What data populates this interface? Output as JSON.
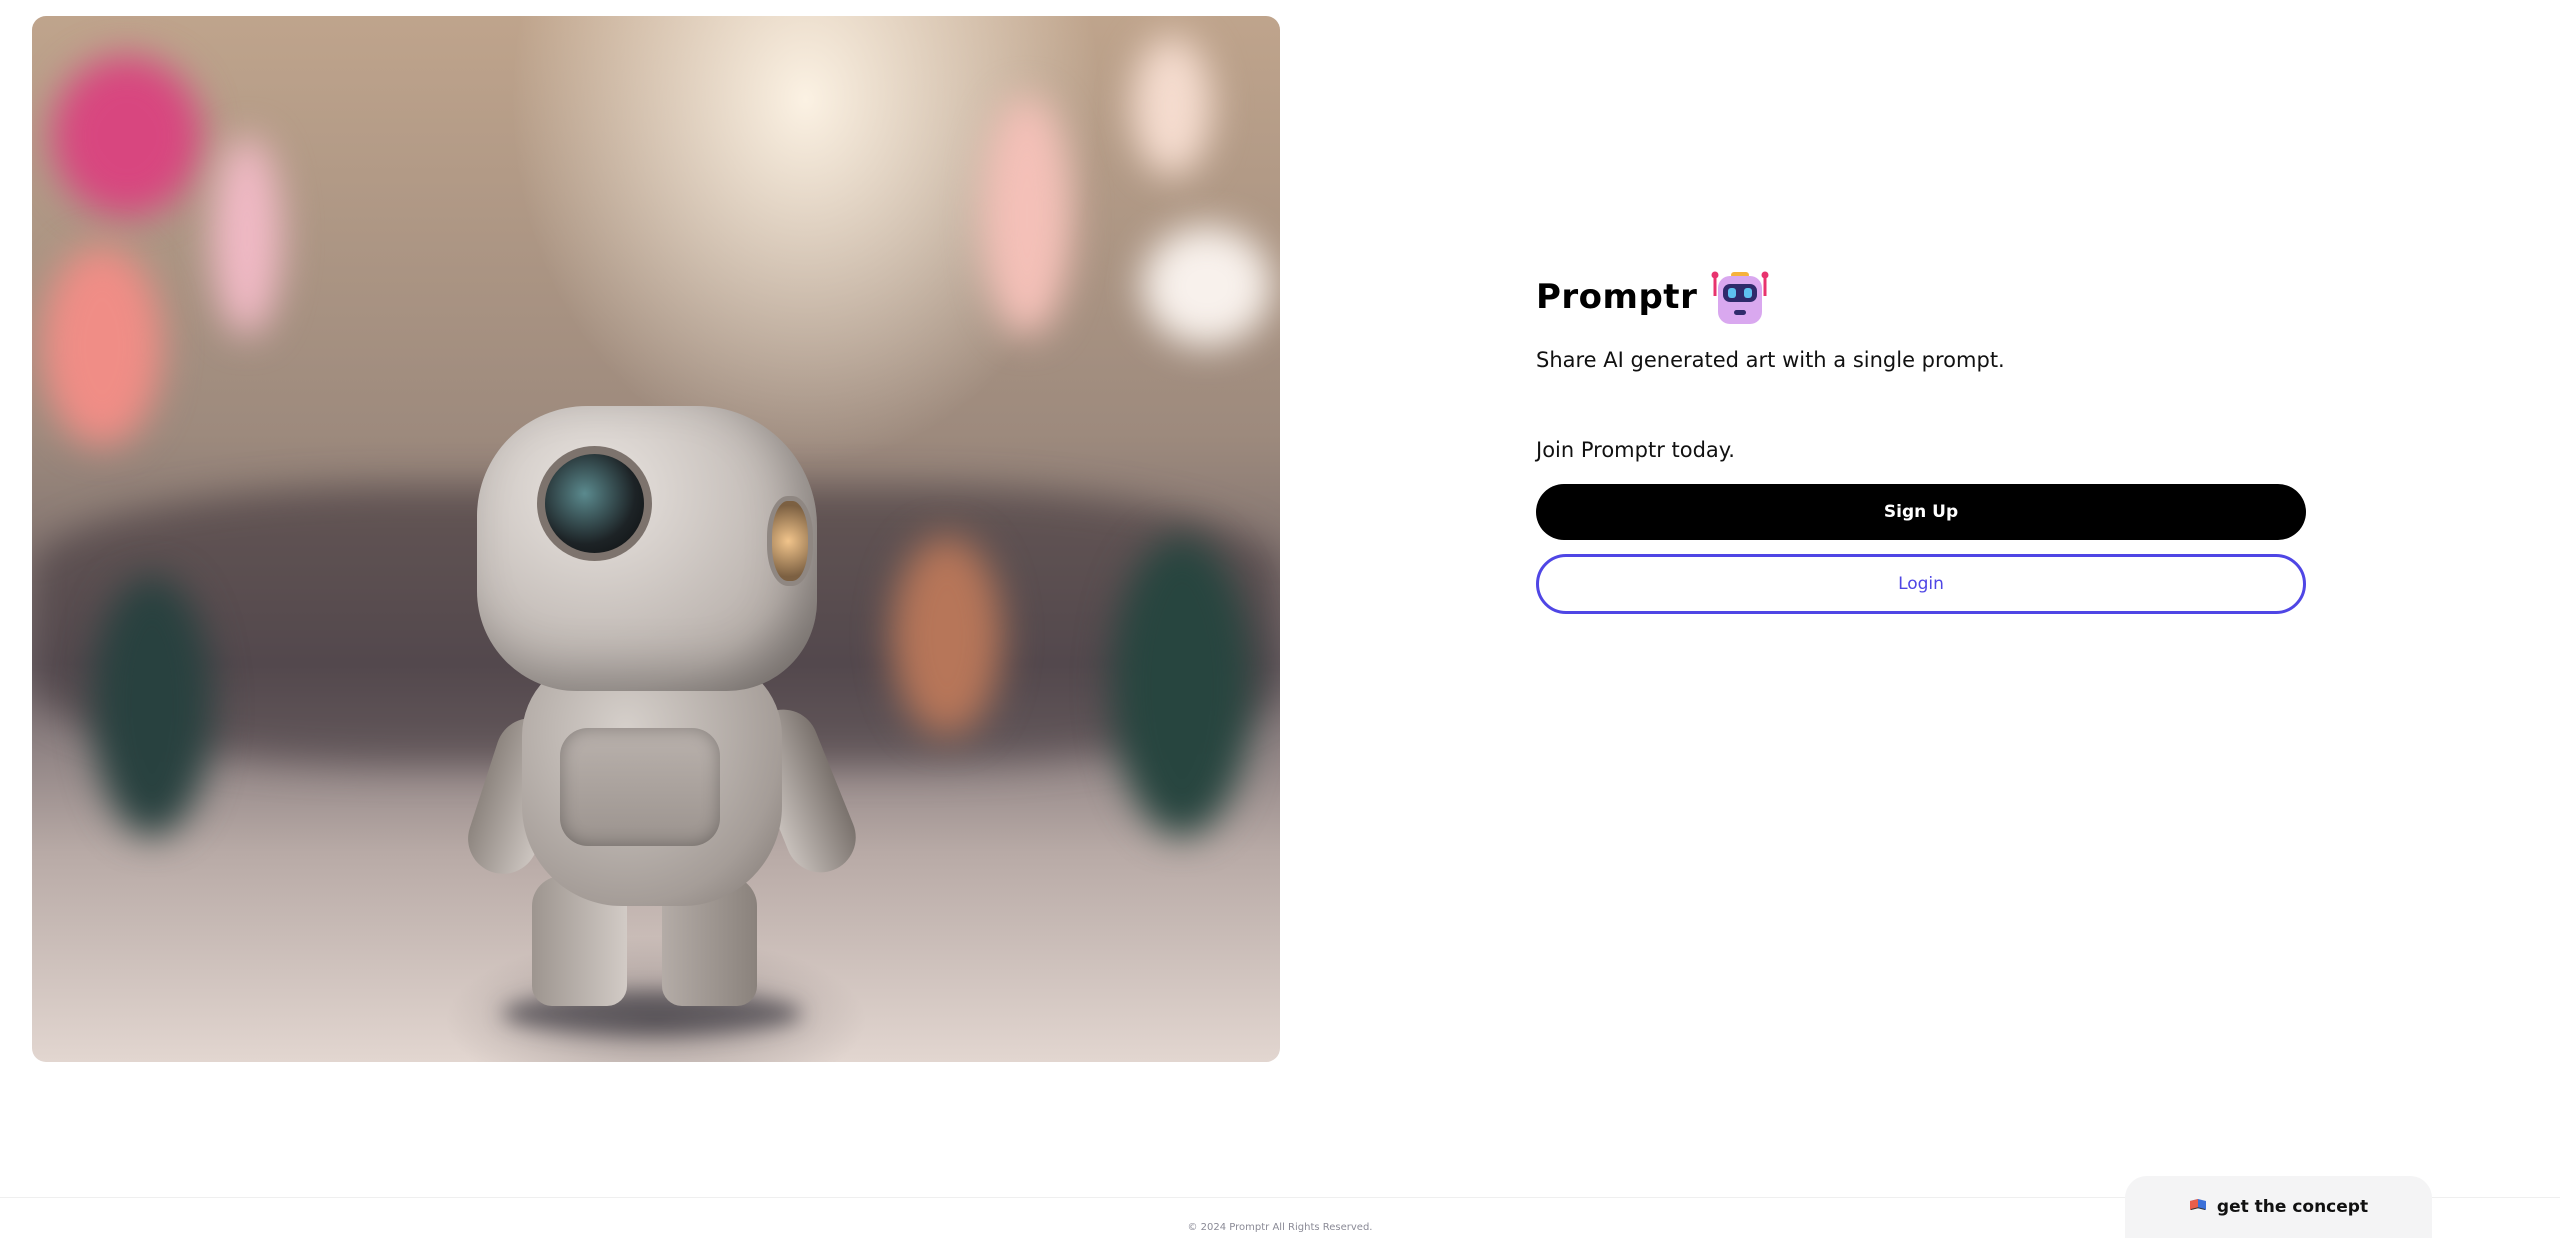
{
  "hero": {
    "subject": "robot-photo"
  },
  "brand": {
    "name": "Promptr",
    "icon": "robot-icon"
  },
  "tagline": "Share AI generated art with a single prompt.",
  "join_text": "Join Promptr today.",
  "buttons": {
    "signup_label": "Sign Up",
    "login_label": "Login"
  },
  "footer": {
    "copyright": "© 2024 Promptr All Rights Reserved.",
    "concept_label": "get the concept",
    "concept_icon": "book-icon"
  },
  "colors": {
    "primary": "#000000",
    "accent": "#4f46e5",
    "background": "#ffffff"
  }
}
